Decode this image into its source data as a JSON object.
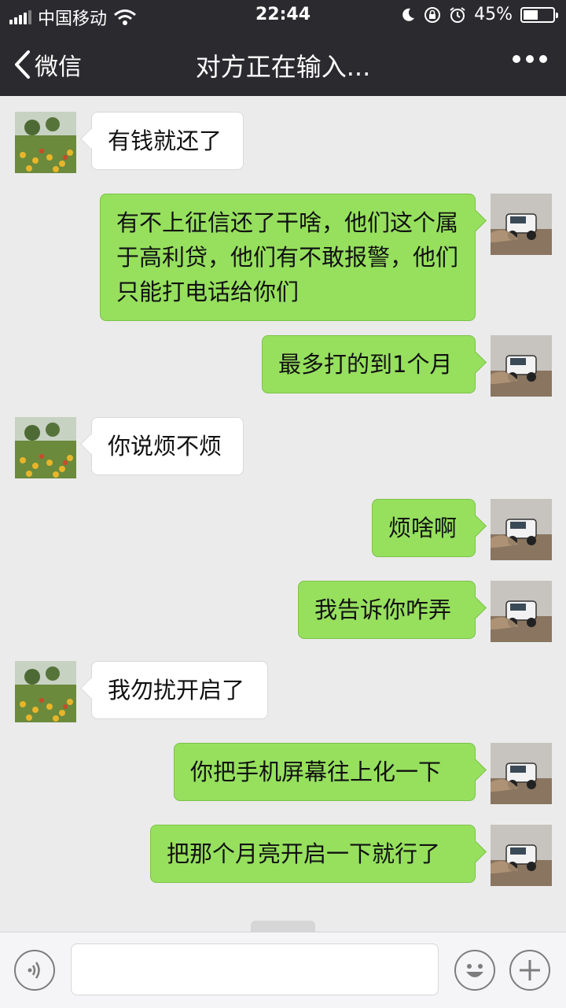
{
  "status_bar": {
    "carrier": "中国移动",
    "time": "22:44",
    "battery_percent": "45%",
    "battery_level": 0.45
  },
  "nav": {
    "back_label": "微信",
    "title": "对方正在输入..."
  },
  "messages": [
    {
      "side": "left",
      "text": "有钱就还了"
    },
    {
      "side": "right",
      "text": "有不上征信还了干啥，他们这个属于高利贷，他们有不敢报警，他们只能打电话给你们"
    },
    {
      "side": "right",
      "text": "最多打的到1个月"
    },
    {
      "side": "left",
      "text": "你说烦不烦"
    },
    {
      "side": "right",
      "text": "烦啥啊"
    },
    {
      "side": "right",
      "text": "我告诉你咋弄"
    },
    {
      "side": "left",
      "text": "我勿扰开启了"
    },
    {
      "side": "right",
      "text": "你把手机屏幕往上化一下"
    },
    {
      "side": "right",
      "text": "把那个月亮开启一下就行了"
    }
  ],
  "icons": {
    "back": "chevron-left-icon",
    "more": "more-dots-icon",
    "voice": "voice-icon",
    "emoji": "emoji-icon",
    "add": "plus-icon"
  },
  "colors": {
    "sent_bubble": "#96e05e",
    "received_bubble": "#ffffff",
    "header": "#2b2b2f"
  }
}
